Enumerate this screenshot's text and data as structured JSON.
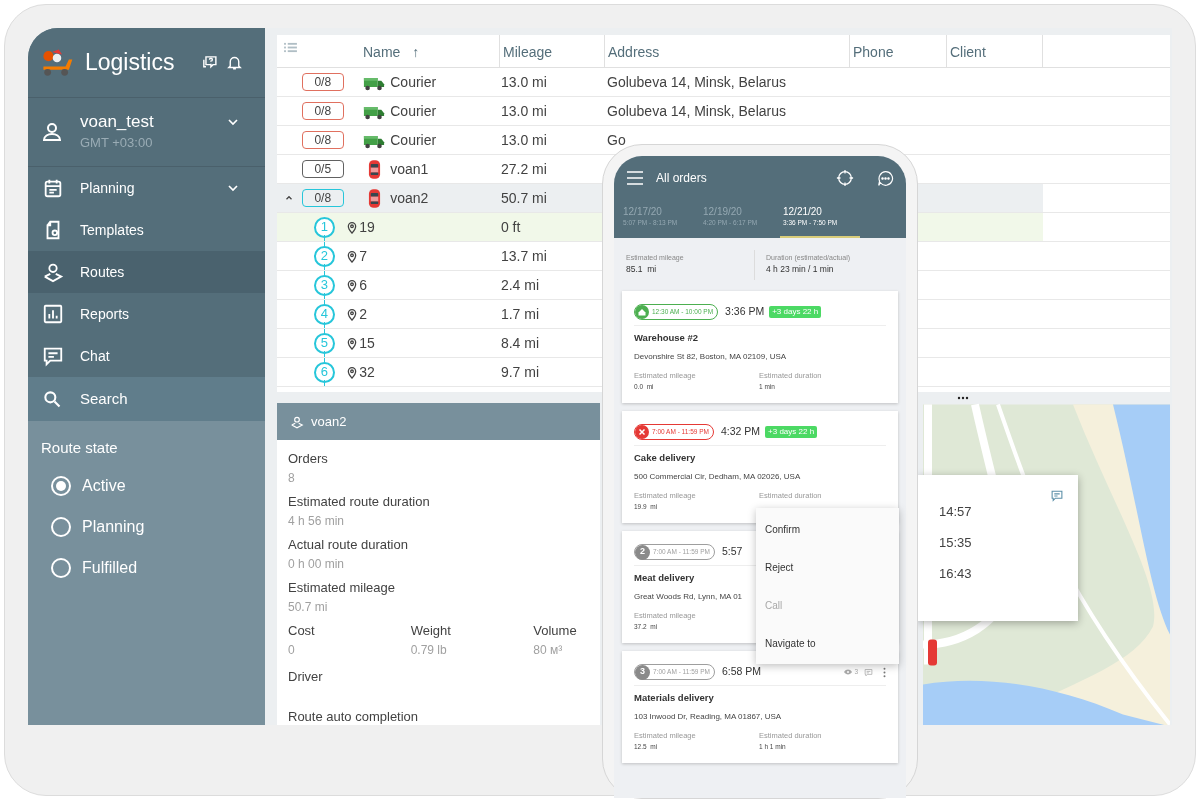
{
  "app": {
    "title": "Logistics"
  },
  "user": {
    "name": "voan_test",
    "timezone": "GMT +03:00"
  },
  "nav": [
    {
      "label": "Planning",
      "has_submenu": true,
      "selected": false
    },
    {
      "label": "Templates",
      "has_submenu": false,
      "selected": false
    },
    {
      "label": "Routes",
      "has_submenu": false,
      "selected": true
    },
    {
      "label": "Reports",
      "has_submenu": false,
      "selected": false
    },
    {
      "label": "Chat",
      "has_submenu": false,
      "selected": false
    }
  ],
  "search": {
    "label": "Search"
  },
  "route_state": {
    "title": "Route state",
    "options": [
      {
        "label": "Active",
        "selected": true
      },
      {
        "label": "Planning",
        "selected": false
      },
      {
        "label": "Fulfilled",
        "selected": false
      }
    ]
  },
  "table": {
    "columns": [
      {
        "label": "Name",
        "sort_mark": "↑"
      },
      {
        "label": "Mileage"
      },
      {
        "label": "Address"
      },
      {
        "label": "Phone"
      },
      {
        "label": "Client"
      }
    ],
    "rows": [
      {
        "kind": "truck",
        "count": "0/8",
        "color": "#e0705f",
        "name": "Courier",
        "mileage": "13.0 mi",
        "address": "Golubeva 14, Minsk, Belarus",
        "expanded": false,
        "selected": false
      },
      {
        "kind": "truck",
        "count": "0/8",
        "color": "#e0705f",
        "name": "Courier",
        "mileage": "13.0 mi",
        "address": "Golubeva 14, Minsk, Belarus",
        "expanded": false,
        "selected": false
      },
      {
        "kind": "truck",
        "count": "0/8",
        "color": "#e0705f",
        "name": "Courier",
        "mileage": "13.0 mi",
        "address": "Go",
        "expanded": false,
        "selected": false
      },
      {
        "kind": "car",
        "count": "0/5",
        "color": "#616161",
        "name": "voan1",
        "mileage": "27.2 mi",
        "expanded": false,
        "selected": false
      },
      {
        "kind": "car",
        "count": "0/8",
        "color": "#26c6da",
        "name": "voan2",
        "mileage": "50.7 mi",
        "expanded": true,
        "selected": true
      },
      {
        "kind": "stop",
        "seq": "1",
        "stop": "19",
        "mileage": "0 ft",
        "selected": true
      },
      {
        "kind": "stop",
        "seq": "2",
        "stop": "7",
        "mileage": "13.7 mi",
        "selected": false
      },
      {
        "kind": "stop",
        "seq": "3",
        "stop": "6",
        "mileage": "2.4 mi",
        "selected": false
      },
      {
        "kind": "stop",
        "seq": "4",
        "stop": "2",
        "mileage": "1.7 mi",
        "selected": false
      },
      {
        "kind": "stop",
        "seq": "5",
        "stop": "15",
        "mileage": "8.4 mi",
        "selected": false
      },
      {
        "kind": "stop",
        "seq": "6",
        "stop": "32",
        "mileage": "9.7 mi",
        "selected": false
      }
    ]
  },
  "details": {
    "title": "voan2",
    "fields": [
      {
        "label": "Orders",
        "value": "8"
      },
      {
        "label": "Estimated route duration",
        "value": "4 h 56 min"
      },
      {
        "label": "Actual route duration",
        "value": "0 h 00 min"
      },
      {
        "label": "Estimated mileage",
        "value": "50.7 mi"
      }
    ],
    "metrics": [
      {
        "label": "Cost",
        "value": "0"
      },
      {
        "label": "Weight",
        "value": "0.79 lb"
      },
      {
        "label": "Volume",
        "value": "80 м³"
      }
    ],
    "more": [
      {
        "label": "Driver"
      },
      {
        "label": "Route auto completion"
      }
    ]
  },
  "map_popup": {
    "times": [
      "14:57",
      "15:35",
      "16:43"
    ]
  },
  "phone": {
    "title": "All orders",
    "date_tabs": [
      {
        "date": "12/17/20",
        "time": "5:07 PM - 8:13 PM",
        "selected": false
      },
      {
        "date": "12/19/20",
        "time": "4:20 PM - 6:17 PM",
        "selected": false
      },
      {
        "date": "12/21/20",
        "time": "3:36 PM - 7:50 PM",
        "selected": true
      }
    ],
    "summary": [
      {
        "label": "Estimated mileage",
        "value": "85.1  mi"
      },
      {
        "label": "Duration (estimated/actual)",
        "value": "4 h 23 min / 1 min"
      }
    ],
    "orders": [
      {
        "kind": "home",
        "window": "12:30 AM - 10:00 PM",
        "eta": "3:36 PM",
        "delay": "+3 days 22 h",
        "name": "Warehouse #2",
        "address": "Devonshire St 82, Boston, MA 02109, USA",
        "stats": [
          {
            "label": "Estimated mileage",
            "value": "0.0  mi"
          },
          {
            "label": "Estimated duration",
            "value": "1 min"
          }
        ]
      },
      {
        "kind": "rejected",
        "window": "7:00 AM - 11:59 PM",
        "eta": "4:32 PM",
        "delay": "+3 days 22 h",
        "name": "Cake delivery",
        "address": "500 Commercial Cir, Dedham, MA 02026, USA",
        "stats": [
          {
            "label": "Estimated mileage",
            "value": "19.9  mi"
          },
          {
            "label": "Estimated duration"
          }
        ]
      },
      {
        "kind": "numbered",
        "number": "2",
        "window": "7:00 AM - 11:59 PM",
        "eta": "5:57",
        "name": "Meat delivery",
        "address": "Great Woods Rd, Lynn, MA 01",
        "stats": [
          {
            "label": "Estimated mileage",
            "value": "37.2  mi"
          }
        ]
      },
      {
        "kind": "numbered",
        "number": "3",
        "window": "7:00 AM - 11:59 PM",
        "eta": "6:58 PM",
        "views": "3",
        "name": "Materials delivery",
        "address": "103 Inwood Dr, Reading, MA 01867, USA",
        "stats": [
          {
            "label": "Estimated mileage",
            "value": "12.5  mi"
          },
          {
            "label": "Estimated duration",
            "value": "1 h 1 min"
          }
        ]
      }
    ],
    "menu": [
      {
        "label": "Confirm",
        "disabled": false
      },
      {
        "label": "Reject",
        "disabled": false
      },
      {
        "label": "Call",
        "disabled": true
      },
      {
        "label": "Navigate to",
        "disabled": false
      }
    ]
  }
}
